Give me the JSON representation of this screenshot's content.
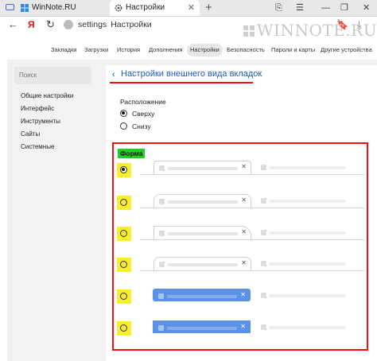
{
  "browser": {
    "tabs": [
      {
        "title": "WinNote.RU",
        "active": false
      },
      {
        "title": "Настройки",
        "active": true
      }
    ],
    "new_tab_glyph": "+",
    "address": {
      "scheme_label": "settings",
      "page_label": "Настройки"
    },
    "yandex_glyph": "Я"
  },
  "watermark": "WINNOTE.RU",
  "settings_nav": [
    "Закладки",
    "Загрузки",
    "История",
    "Дополнения",
    "Настройки",
    "Безопасность",
    "Пароли и карты",
    "Другие устройства"
  ],
  "settings_nav_active": "Настройки",
  "sidebar": {
    "search_placeholder": "Поиск",
    "items": [
      "Общие настройки",
      "Интерфейс",
      "Инструменты",
      "Сайты",
      "Системные"
    ]
  },
  "page": {
    "title": "Настройки внешнего вида вкладок",
    "position_label": "Расположение",
    "position_options": [
      {
        "label": "Сверху",
        "selected": true
      },
      {
        "label": "Снизу",
        "selected": false
      }
    ],
    "shape_label": "Форма",
    "shape_options": [
      {
        "style": "standard",
        "selected": true
      },
      {
        "style": "rounded",
        "selected": false
      },
      {
        "style": "slanted",
        "selected": false
      },
      {
        "style": "soft",
        "selected": false
      },
      {
        "style": "blue-rounded",
        "selected": false
      },
      {
        "style": "blue-flat",
        "selected": false
      }
    ]
  },
  "colors": {
    "accent": "#1a5cc7",
    "highlight": "#f7ef2c",
    "forma_bg": "#1fd020",
    "annotation": "#e11111",
    "tab_blue": "#5b92e5"
  }
}
